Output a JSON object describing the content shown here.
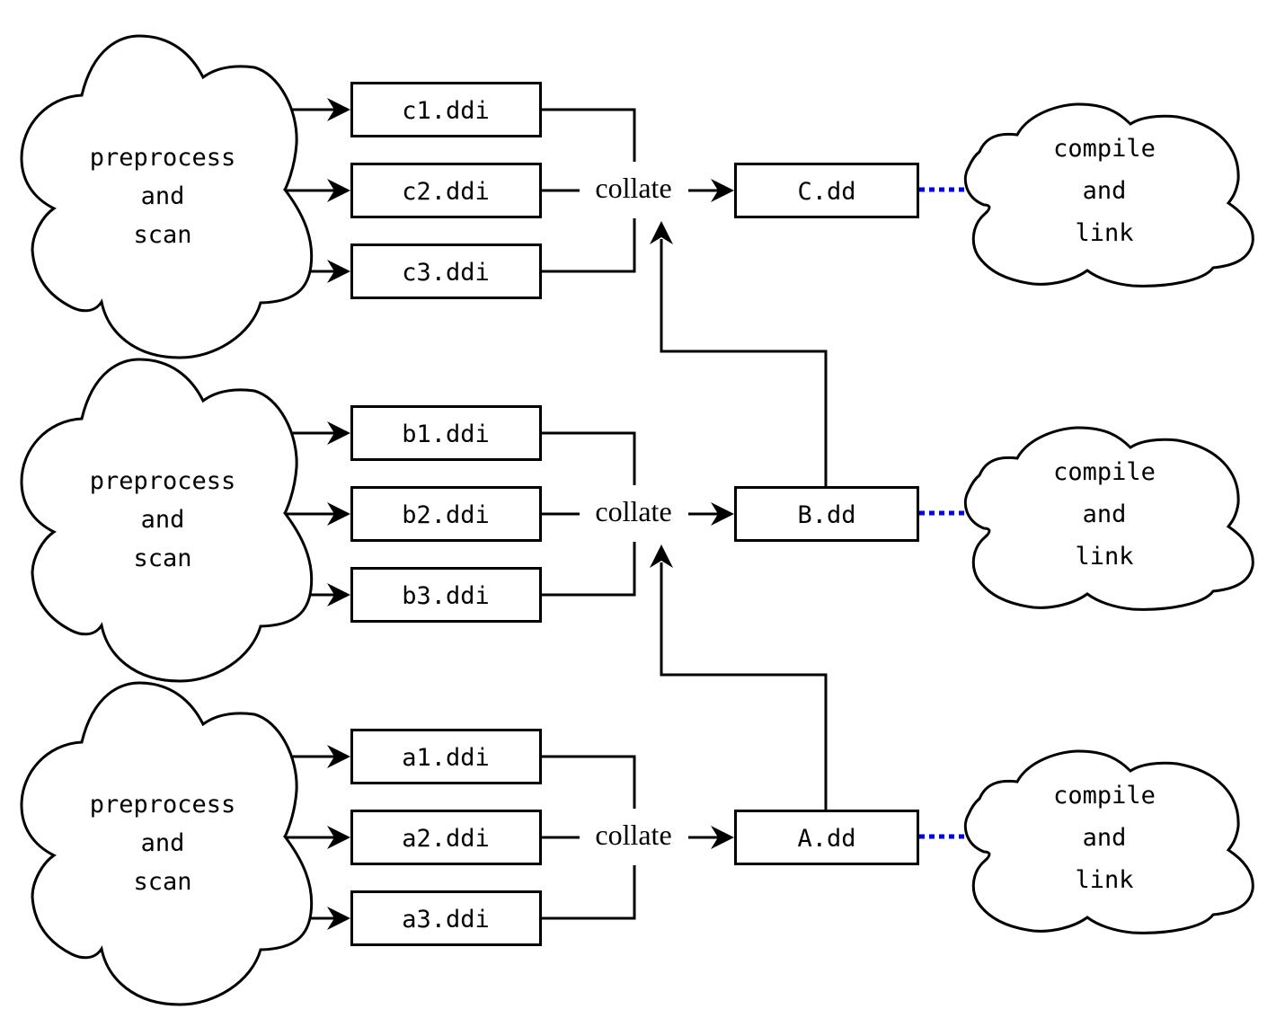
{
  "diagram": {
    "type": "build-pipeline",
    "colors": {
      "line": "#000000",
      "dotted_link": "#0000ee",
      "background": "#ffffff"
    },
    "groups": [
      {
        "id": "c",
        "source_cloud": [
          "preprocess",
          "and",
          "scan"
        ],
        "ddi_files": [
          "c1.ddi",
          "c2.ddi",
          "c3.ddi"
        ],
        "collate_label": "collate",
        "dd_file": "C.dd",
        "sink_cloud": [
          "compile",
          "and",
          "link"
        ],
        "feeds_into": null
      },
      {
        "id": "b",
        "source_cloud": [
          "preprocess",
          "and",
          "scan"
        ],
        "ddi_files": [
          "b1.ddi",
          "b2.ddi",
          "b3.ddi"
        ],
        "collate_label": "collate",
        "dd_file": "B.dd",
        "sink_cloud": [
          "compile",
          "and",
          "link"
        ],
        "feeds_into": "c"
      },
      {
        "id": "a",
        "source_cloud": [
          "preprocess",
          "and",
          "scan"
        ],
        "ddi_files": [
          "a1.ddi",
          "a2.ddi",
          "a3.ddi"
        ],
        "collate_label": "collate",
        "dd_file": "A.dd",
        "sink_cloud": [
          "compile",
          "and",
          "link"
        ],
        "feeds_into": "b"
      }
    ]
  }
}
